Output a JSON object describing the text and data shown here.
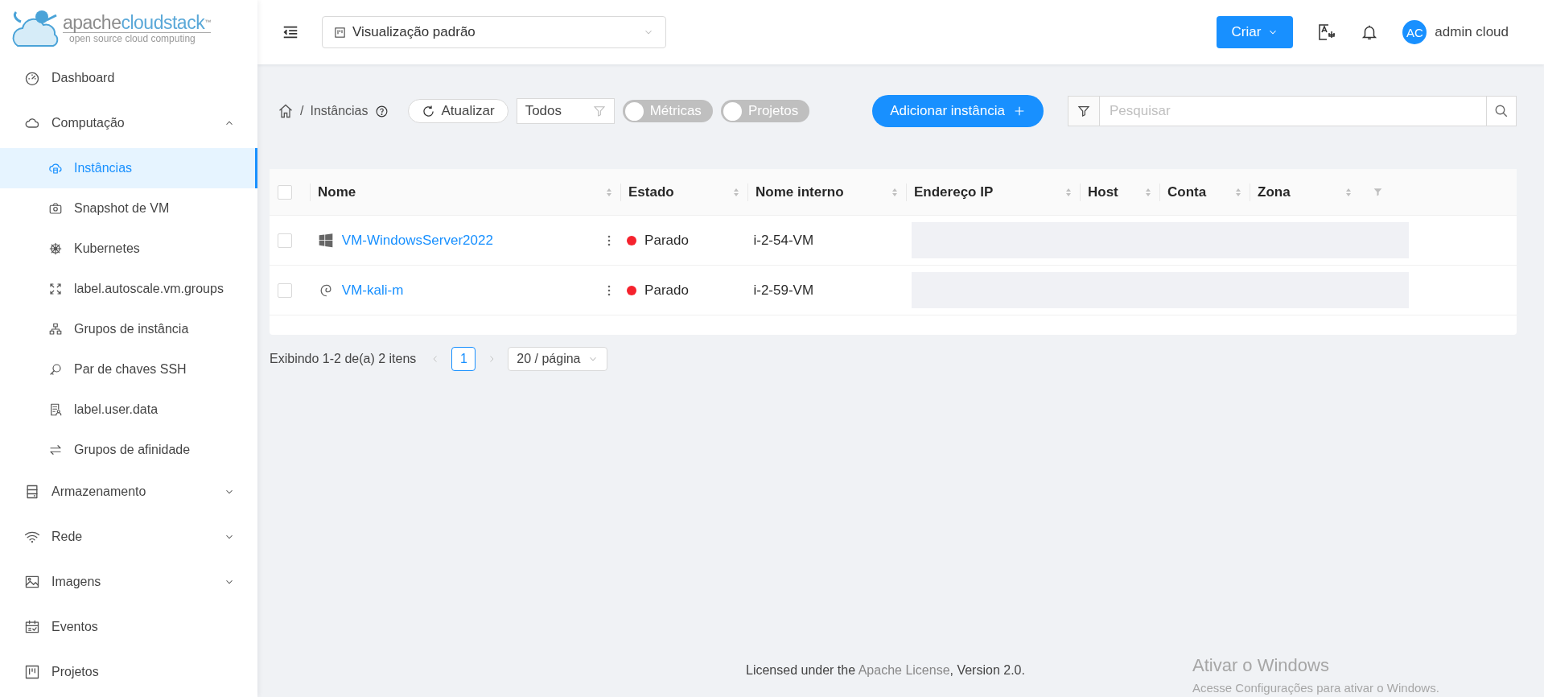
{
  "logo": {
    "word_1": "apache",
    "word_2": "cloudstack",
    "trademark": "™",
    "tagline": "open source cloud computing"
  },
  "header": {
    "view_select": "Visualização padrão",
    "create_button": "Criar",
    "user": {
      "initials": "AC",
      "name": "admin cloud"
    }
  },
  "sidebar": {
    "items": [
      {
        "label": "Dashboard",
        "selected": false
      },
      {
        "label": "Computação",
        "selected": false,
        "expanded": true,
        "children": [
          {
            "label": "Instâncias",
            "selected": true
          },
          {
            "label": "Snapshot de VM",
            "selected": false
          },
          {
            "label": "Kubernetes",
            "selected": false
          },
          {
            "label": "label.autoscale.vm.groups",
            "selected": false
          },
          {
            "label": "Grupos de instância",
            "selected": false
          },
          {
            "label": "Par de chaves SSH",
            "selected": false
          },
          {
            "label": "label.user.data",
            "selected": false
          },
          {
            "label": "Grupos de afinidade",
            "selected": false
          }
        ]
      },
      {
        "label": "Armazenamento",
        "selected": false,
        "expanded": false
      },
      {
        "label": "Rede",
        "selected": false,
        "expanded": false
      },
      {
        "label": "Imagens",
        "selected": false,
        "expanded": false
      },
      {
        "label": "Eventos",
        "selected": false
      },
      {
        "label": "Projetos",
        "selected": false
      }
    ]
  },
  "toolbar": {
    "breadcrumb_separator": "/",
    "breadcrumb": "Instâncias",
    "refresh_button": "Atualizar",
    "filter_select": "Todos",
    "toggles": [
      {
        "label": "Métricas",
        "on": false
      },
      {
        "label": "Projetos",
        "on": false
      }
    ],
    "add_button": "Adicionar instância",
    "search": {
      "placeholder": "Pesquisar"
    }
  },
  "table": {
    "all_checked": false,
    "columns": [
      "Nome",
      "Estado",
      "Nome interno",
      "Endereço IP",
      "Host",
      "Conta",
      "Zona"
    ],
    "rows": [
      {
        "checked": false,
        "kind": "windows",
        "name": "VM-WindowsServer2022",
        "state": "Parado",
        "color": "#f5222d",
        "internal_name": "i-2-54-VM"
      },
      {
        "checked": false,
        "kind": "debian",
        "name": "VM-kali-m",
        "state": "Parado",
        "color": "#f5222d",
        "internal_name": "i-2-59-VM"
      }
    ]
  },
  "pagination": {
    "summary": "Exibindo 1-2 de(a) 2 itens",
    "pages": [
      {
        "label": "1",
        "selected": true
      }
    ],
    "page_size": "20 / página"
  },
  "footer": {
    "text_before": "Licensed under the ",
    "link": "Apache License",
    "text_after": ", Version 2.0."
  },
  "windows_notice": {
    "title": "Ativar o Windows",
    "text": "Acesse Configurações para ativar o Windows."
  }
}
